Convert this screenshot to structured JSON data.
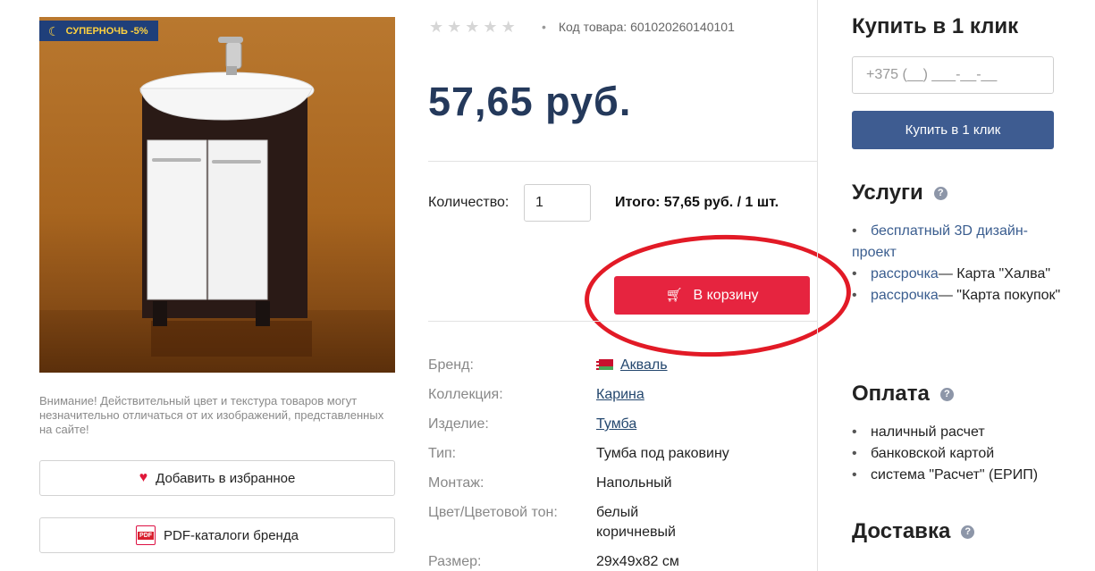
{
  "promo": {
    "badge_label": "СУПЕРНОЧЬ -5%"
  },
  "product": {
    "sku_label": "Код товара:",
    "sku": "601020260140101",
    "price": "57,65 руб.",
    "rating": {
      "value": 0,
      "max": 5
    }
  },
  "left": {
    "disclaimer": "Внимание! Действительный цвет и текстура товаров могут незначительно отличаться от их изображений, представленных на сайте!",
    "favorite_label": "Добавить в избранное",
    "pdf_label": "PDF-каталоги бренда",
    "pdf_icon_text": "PDF"
  },
  "purchase": {
    "qty_label": "Количество:",
    "qty_value": "1",
    "total_text": "Итого: 57,65 руб. / 1 шт.",
    "cart_label": "В корзину"
  },
  "specs": [
    {
      "label": "Бренд:",
      "value": "Акваль",
      "link": true,
      "flag": true
    },
    {
      "label": "Коллекция:",
      "value": "Карина",
      "link": true
    },
    {
      "label": "Изделие:",
      "value": "Тумба",
      "link": true
    },
    {
      "label": "Тип:",
      "value": "Тумба под раковину"
    },
    {
      "label": "Монтаж:",
      "value": "Напольный"
    },
    {
      "label": "Цвет/Цветовой тон:",
      "value": "белый",
      "value2": "коричневый"
    },
    {
      "label": "Размер:",
      "value": "29x49x82 см"
    }
  ],
  "buy_one_click": {
    "title": "Купить в 1 клик",
    "phone_placeholder": "+375 (__) ___-__-__",
    "button_label": "Купить в 1 клик"
  },
  "services": {
    "title": "Услуги",
    "items": [
      {
        "link": "бесплатный 3D дизайн-проект",
        "text": ""
      },
      {
        "link": "рассрочка",
        "text": "— Карта \"Халва\""
      },
      {
        "link": "рассрочка",
        "text": "— \"Карта покупок\""
      }
    ]
  },
  "payment": {
    "title": "Оплата",
    "items": [
      "наличный расчет",
      "банковской картой",
      "система \"Расчет\" (ЕРИП)"
    ]
  },
  "delivery": {
    "title": "Доставка"
  },
  "colors": {
    "price": "#24395b",
    "cart_button": "#e6243f",
    "buy_button": "#3e5c91",
    "highlight_ellipse": "#e21a26"
  }
}
